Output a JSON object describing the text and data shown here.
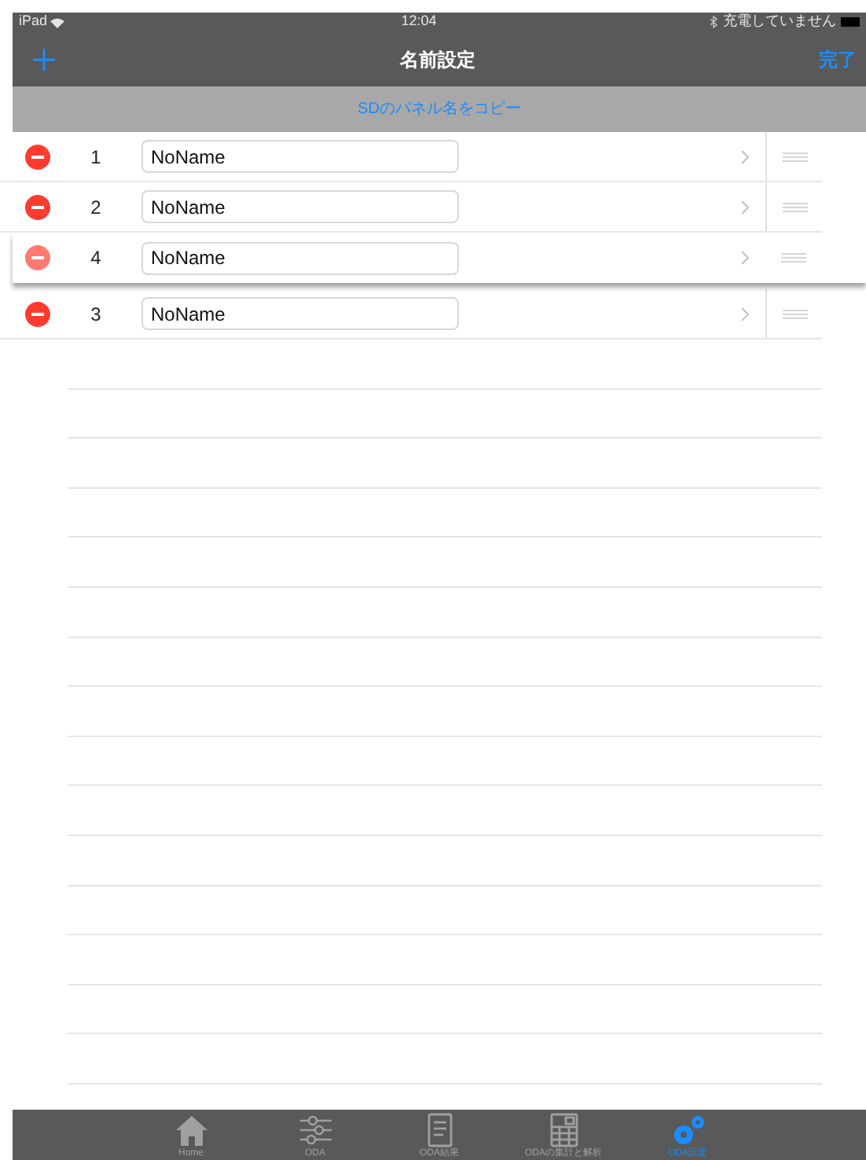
{
  "status_bar": {
    "device": "iPad",
    "time": "12:04",
    "battery_text": "充電していません"
  },
  "nav": {
    "title": "名前設定",
    "done": "完了"
  },
  "copy_button": "SDのパネル名をコピー",
  "rows": [
    {
      "number": "1",
      "value": "NoName",
      "dragging": false
    },
    {
      "number": "2",
      "value": "NoName",
      "dragging": false
    },
    {
      "number": "4",
      "value": "NoName",
      "dragging": true
    },
    {
      "number": "3",
      "value": "NoName",
      "dragging": false
    }
  ],
  "tabs": [
    {
      "label": "Home",
      "kind": "home",
      "selected": false
    },
    {
      "label": "ODA",
      "kind": "sliders",
      "selected": false
    },
    {
      "label": "ODA結果",
      "kind": "document",
      "selected": false
    },
    {
      "label": "ODAの集計と解析",
      "kind": "calculator",
      "selected": false
    },
    {
      "label": "ODA設定",
      "kind": "gears",
      "selected": true
    }
  ]
}
